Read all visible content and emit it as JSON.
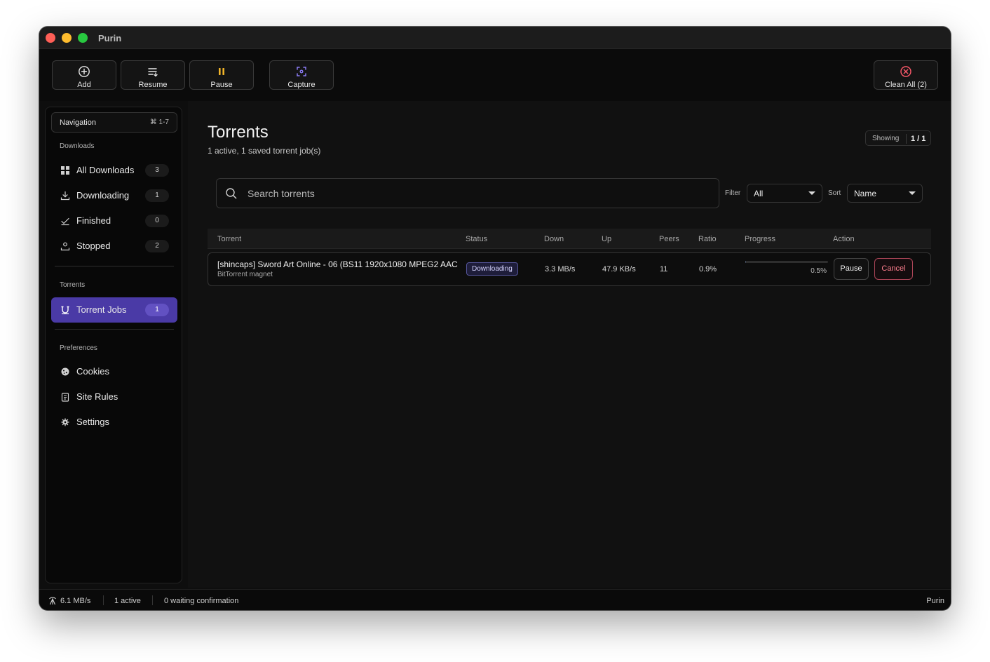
{
  "window": {
    "title": "Purin"
  },
  "toolbar": {
    "add_label": "Add",
    "resume_label": "Resume",
    "pause_label": "Pause",
    "capture_label": "Capture",
    "clean_all_label": "Clean All (2)"
  },
  "sidebar": {
    "nav_header": "Navigation",
    "nav_shortcut": "⌘ 1-7",
    "downloads_section": "Downloads",
    "items": [
      {
        "label": "All Downloads",
        "count": "3",
        "icon": "grid-icon"
      },
      {
        "label": "Downloading",
        "count": "1",
        "icon": "download-icon"
      },
      {
        "label": "Finished",
        "count": "0",
        "icon": "check-icon"
      },
      {
        "label": "Stopped",
        "count": "2",
        "icon": "stop-icon"
      }
    ],
    "torrents_section": "Torrents",
    "torrent_jobs": {
      "label": "Torrent Jobs",
      "count": "1",
      "icon": "magnet-icon"
    },
    "preferences_section": "Preferences",
    "prefs": [
      {
        "label": "Cookies",
        "icon": "cookie-icon"
      },
      {
        "label": "Site Rules",
        "icon": "clipboard-icon"
      },
      {
        "label": "Settings",
        "icon": "gear-icon"
      }
    ]
  },
  "main": {
    "title": "Torrents",
    "subtitle": "1 active, 1 saved torrent job(s)",
    "showing_label": "Showing",
    "showing_value": "1 / 1",
    "search_placeholder": "Search torrents",
    "filter_label": "Filter",
    "filter_value": "All",
    "sort_label": "Sort",
    "sort_value": "Name",
    "columns": [
      "Torrent",
      "Status",
      "Down",
      "Up",
      "Peers",
      "Ratio",
      "Progress",
      "Action"
    ],
    "rows": [
      {
        "name": "[shincaps] Sword Art Online - 06 (BS11 1920x1080 MPEG2 AAC",
        "source": "BitTorrent magnet",
        "status": "Downloading",
        "down": "3.3 MB/s",
        "up": "47.9 KB/s",
        "peers": "11",
        "ratio": "0.9%",
        "progress": 0.5,
        "progress_label": "0.5%",
        "pause_label": "Pause",
        "cancel_label": "Cancel"
      }
    ]
  },
  "statusbar": {
    "speed": "6.1 MB/s",
    "active": "1 active",
    "waiting": "0 waiting confirmation",
    "app": "Purin"
  },
  "colors": {
    "accent": "#4a3aa6",
    "pause_icon": "#f0b429",
    "capture_icon": "#8b7cf6",
    "clean_icon": "#ff5a6b"
  }
}
